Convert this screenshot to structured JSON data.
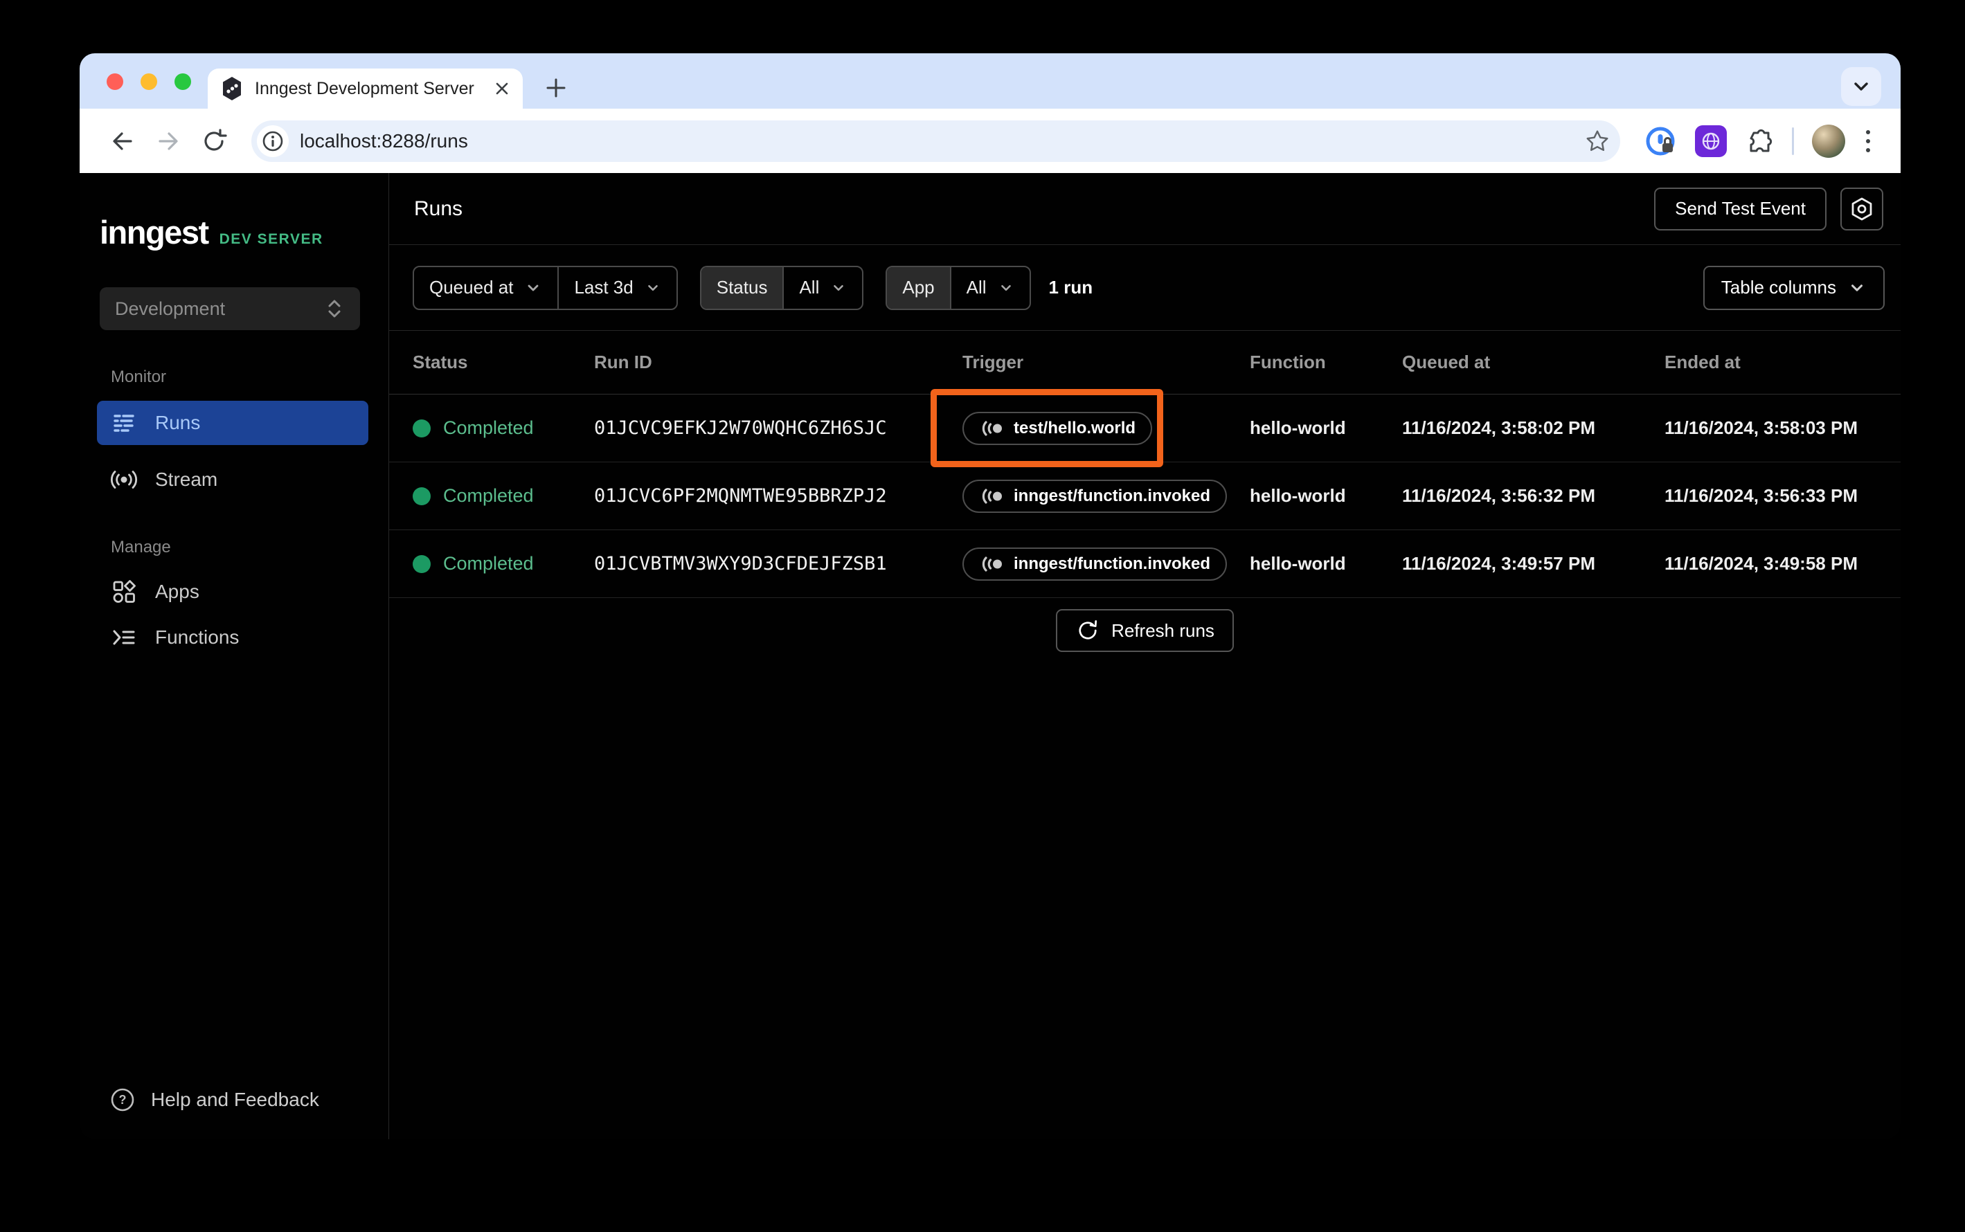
{
  "browser": {
    "tab_title": "Inngest Development Server",
    "url": "localhost:8288/runs"
  },
  "sidebar": {
    "logo": "inngest",
    "logo_badge": "DEV SERVER",
    "env_selector": "Development",
    "sections": [
      {
        "label": "Monitor",
        "items": [
          {
            "label": "Runs",
            "active": true
          },
          {
            "label": "Stream",
            "active": false
          }
        ]
      },
      {
        "label": "Manage",
        "items": [
          {
            "label": "Apps",
            "active": false
          },
          {
            "label": "Functions",
            "active": false
          }
        ]
      }
    ],
    "footer_label": "Help and Feedback"
  },
  "header": {
    "title": "Runs",
    "send_test_event_label": "Send Test Event"
  },
  "filters": {
    "queued_at": {
      "label": "Queued at",
      "value": "Last 3d"
    },
    "status": {
      "label": "Status",
      "value": "All"
    },
    "app": {
      "label": "App",
      "value": "All"
    },
    "run_count": "1 run",
    "table_columns_label": "Table columns"
  },
  "table": {
    "columns": [
      "Status",
      "Run ID",
      "Trigger",
      "Function",
      "Queued at",
      "Ended at"
    ],
    "rows": [
      {
        "status": "Completed",
        "run_id": "01JCVC9EFKJ2W70WQHC6ZH6SJC",
        "trigger": "test/hello.world",
        "function": "hello-world",
        "queued_at": "11/16/2024, 3:58:02 PM",
        "ended_at": "11/16/2024, 3:58:03 PM",
        "highlighted": true
      },
      {
        "status": "Completed",
        "run_id": "01JCVC6PF2MQNMTWE95BBRZPJ2",
        "trigger": "inngest/function.invoked",
        "function": "hello-world",
        "queued_at": "11/16/2024, 3:56:32 PM",
        "ended_at": "11/16/2024, 3:56:33 PM",
        "highlighted": false
      },
      {
        "status": "Completed",
        "run_id": "01JCVBTMV3WXY9D3CFDEJFZSB1",
        "trigger": "inngest/function.invoked",
        "function": "hello-world",
        "queued_at": "11/16/2024, 3:49:57 PM",
        "ended_at": "11/16/2024, 3:49:58 PM",
        "highlighted": false
      }
    ],
    "refresh_label": "Refresh runs"
  },
  "colors": {
    "accent_green": "#44BB85",
    "status_green_dot": "#1C9A63",
    "status_green_text": "#5CBE8E",
    "active_nav_blue": "#1C4396",
    "active_nav_text": "#A9C9F8",
    "annotation_orange": "#F2631B",
    "tab_strip_blue": "#D3E2FB"
  }
}
